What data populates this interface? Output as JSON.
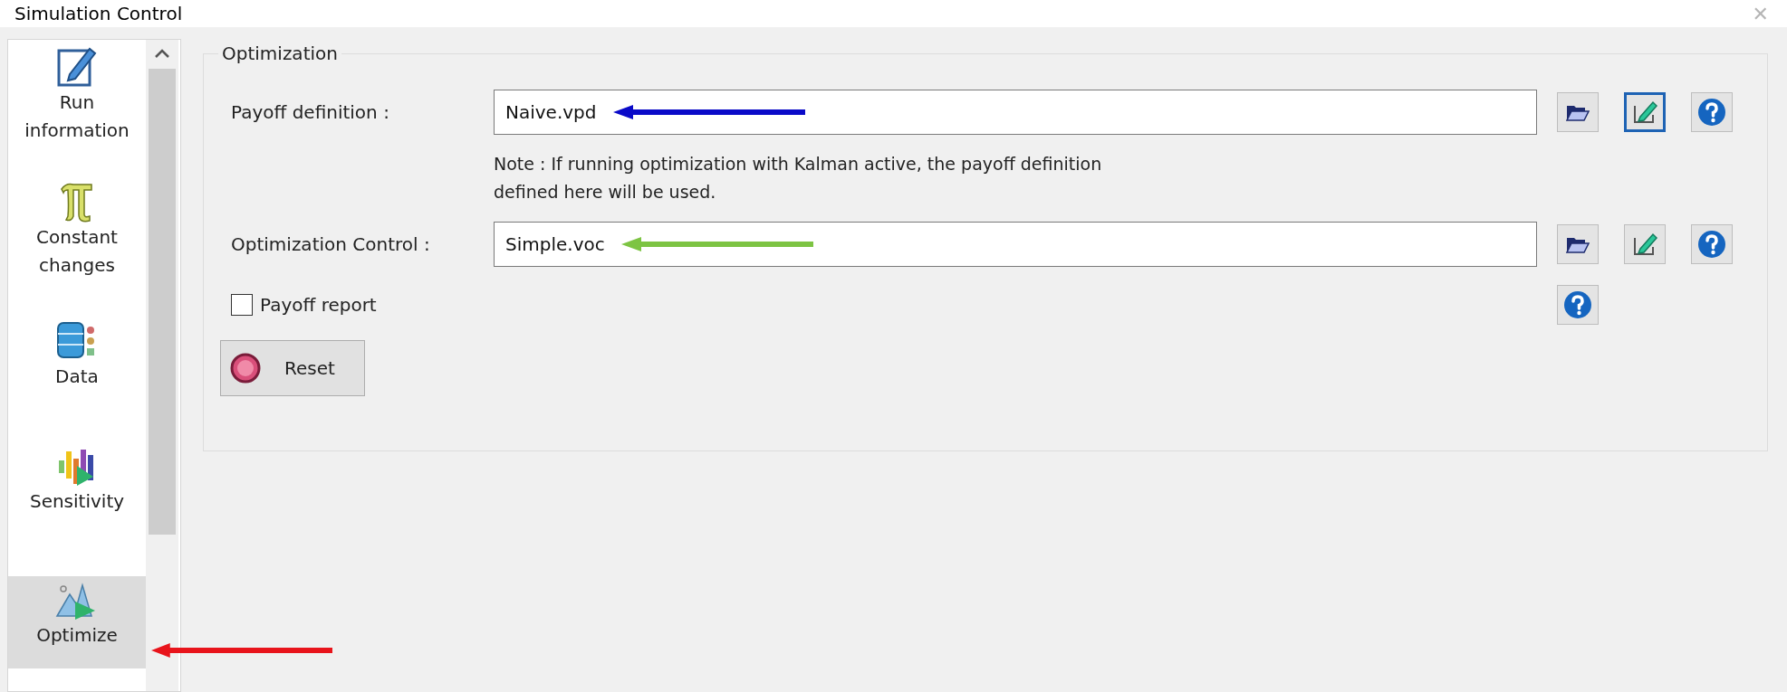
{
  "window": {
    "title": "Simulation Control",
    "close": "✕"
  },
  "sidebar": {
    "items": [
      {
        "kind": "run",
        "label": "Run information",
        "selected": false
      },
      {
        "kind": "constants",
        "label": "Constant changes",
        "selected": false
      },
      {
        "kind": "data",
        "label": "Data",
        "selected": false
      },
      {
        "kind": "sensitivity",
        "label": "Sensitivity",
        "selected": false
      },
      {
        "kind": "optimize",
        "label": "Optimize",
        "selected": true,
        "arrow": {
          "color": "#e8141b"
        }
      }
    ]
  },
  "group": {
    "legend": "Optimization",
    "payoff": {
      "label": "Payoff definition :",
      "value": "Naive.vpd",
      "arrow": {
        "color": "#0a0ac8"
      },
      "buttons": [
        {
          "kind": "open",
          "focused": false
        },
        {
          "kind": "edit",
          "focused": true
        },
        {
          "kind": "help",
          "focused": false
        }
      ]
    },
    "note": "Note : If running optimization with Kalman active, the payoff definition\ndefined here will be used.",
    "control": {
      "label": "Optimization Control :",
      "value": "Simple.voc",
      "arrow": {
        "color": "#7dc443"
      },
      "buttons": [
        {
          "kind": "open",
          "focused": false
        },
        {
          "kind": "edit",
          "focused": false
        },
        {
          "kind": "help",
          "focused": false
        }
      ]
    },
    "payoff_report": {
      "label": "Payoff report",
      "checked": false,
      "buttons": [
        {
          "kind": "help",
          "focused": false
        }
      ]
    },
    "reset_button": {
      "label": "Reset"
    }
  }
}
